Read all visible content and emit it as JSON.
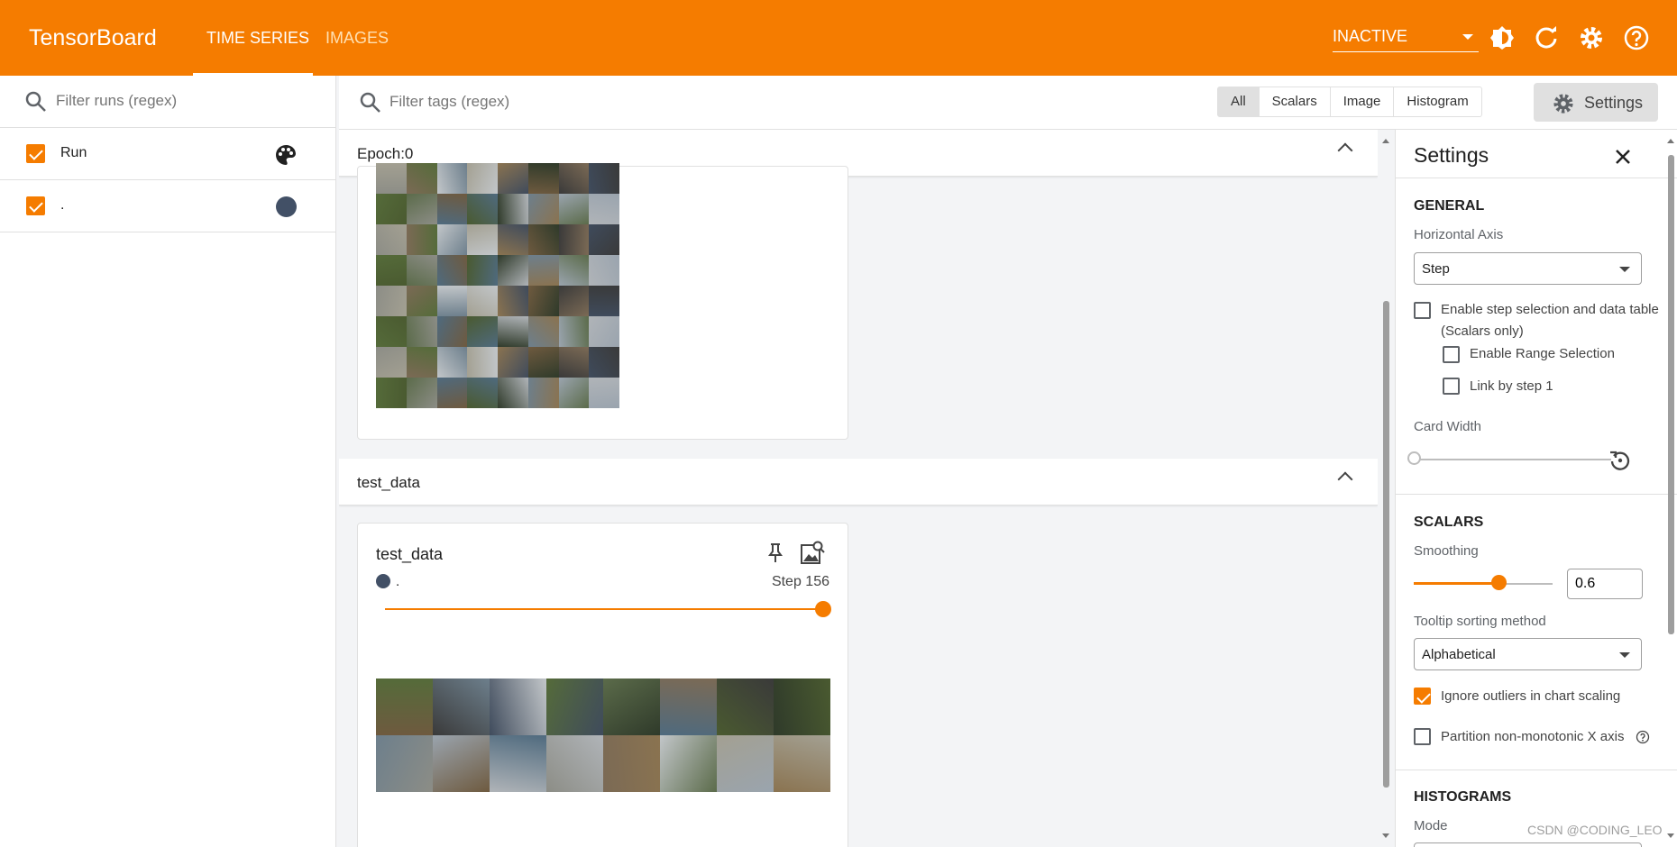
{
  "app": {
    "brand": "TensorBoard"
  },
  "header": {
    "tabs": [
      {
        "label": "TIME SERIES",
        "active": true
      },
      {
        "label": "IMAGES",
        "active": false
      }
    ],
    "status_select": "INACTIVE",
    "icons": [
      "theme-icon",
      "reload-icon",
      "settings-icon",
      "help-icon"
    ]
  },
  "runs": {
    "filter_placeholder": "Filter runs (regex)",
    "items": [
      {
        "label": "Run",
        "checked": true,
        "icon": "palette-icon"
      },
      {
        "label": ".",
        "checked": true,
        "color": "#425066"
      }
    ]
  },
  "toolbar": {
    "tag_filter_placeholder": "Filter tags (regex)",
    "type_filters": [
      "All",
      "Scalars",
      "Image",
      "Histogram"
    ],
    "selected_type": "All",
    "settings_label": "Settings"
  },
  "groups": [
    {
      "title": "Epoch:0"
    },
    {
      "title": "test_data",
      "card": {
        "title": "test_data",
        "run_label": ".",
        "step_label": "Step 156",
        "step_position_pct": 100
      }
    }
  ],
  "settings": {
    "title": "Settings",
    "general": {
      "section": "GENERAL",
      "horizontal_axis_label": "Horizontal Axis",
      "horizontal_axis_value": "Step",
      "step_selection_label": "Enable step selection and data table",
      "step_selection_sub": "(Scalars only)",
      "range_selection_label": "Enable Range Selection",
      "link_by_step_label": "Link by step 1",
      "card_width_label": "Card Width"
    },
    "scalars": {
      "section": "SCALARS",
      "smoothing_label": "Smoothing",
      "smoothing_value": "0.6",
      "tooltip_sort_label": "Tooltip sorting method",
      "tooltip_sort_value": "Alphabetical",
      "ignore_outliers_label": "Ignore outliers in chart scaling",
      "partition_label": "Partition non-monotonic X axis"
    },
    "histograms": {
      "section": "HISTOGRAMS",
      "mode_label": "Mode"
    }
  },
  "watermark": "CSDN @CODING_LEO",
  "colors": {
    "accent": "#f57c00",
    "run_color": "#425066"
  }
}
